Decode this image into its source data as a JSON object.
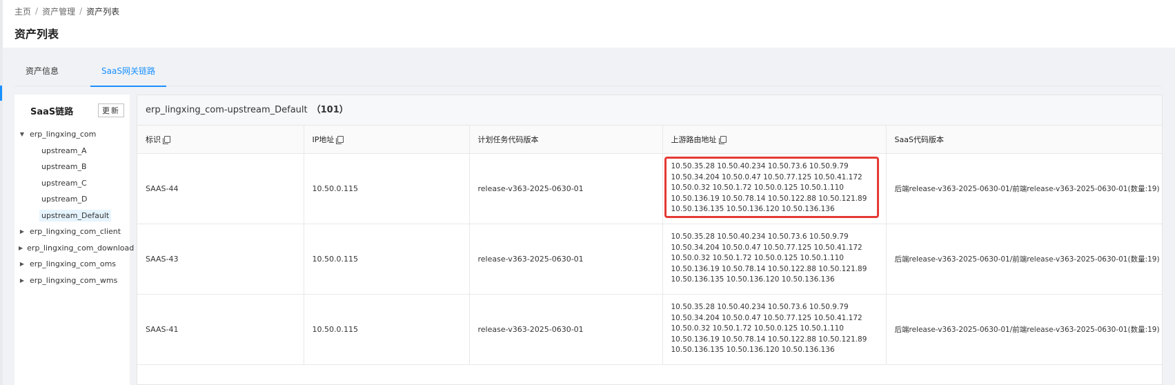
{
  "breadcrumb": {
    "home": "主页",
    "assets": "资产管理",
    "current": "资产列表",
    "sep": "/"
  },
  "page_title": "资产列表",
  "tabs": [
    {
      "label": "资产信息",
      "active": false
    },
    {
      "label": "SaaS网关链路",
      "active": true
    }
  ],
  "sidebar": {
    "title": "SaaS链路",
    "refresh_label": "更新",
    "tree": {
      "expanded": {
        "label": "erp_lingxing_com",
        "children": [
          "upstream_A",
          "upstream_B",
          "upstream_C",
          "upstream_D",
          "upstream_Default"
        ],
        "selected": "upstream_Default"
      },
      "collapsed": [
        "erp_lingxing_com_client",
        "erp_lingxing_com_download",
        "erp_lingxing_com_oms",
        "erp_lingxing_com_wms"
      ]
    }
  },
  "panel": {
    "title": "erp_lingxing_com-upstream_Default",
    "count": "（101）"
  },
  "table": {
    "columns": [
      "标识",
      "IP地址",
      "计划任务代码版本",
      "上游路由地址",
      "SaaS代码版本"
    ],
    "rows": [
      {
        "id": "SAAS-44",
        "ip": "10.50.0.115",
        "plan_version": "release-v363-2025-0630-01",
        "upstream": "10.50.35.28 10.50.40.234 10.50.73.6 10.50.9.79 10.50.34.204 10.50.0.47 10.50.77.125 10.50.41.172 10.50.0.32 10.50.1.72 10.50.0.125 10.50.1.110 10.50.136.19 10.50.78.14 10.50.122.88 10.50.121.89 10.50.136.135 10.50.136.120 10.50.136.136",
        "saas_version": "后端release-v363-2025-0630-01/前端release-v363-2025-0630-01(数量:19)",
        "highlighted": true
      },
      {
        "id": "SAAS-43",
        "ip": "10.50.0.115",
        "plan_version": "release-v363-2025-0630-01",
        "upstream": "10.50.35.28 10.50.40.234 10.50.73.6 10.50.9.79 10.50.34.204 10.50.0.47 10.50.77.125 10.50.41.172 10.50.0.32 10.50.1.72 10.50.0.125 10.50.1.110 10.50.136.19 10.50.78.14 10.50.122.88 10.50.121.89 10.50.136.135 10.50.136.120 10.50.136.136",
        "saas_version": "后端release-v363-2025-0630-01/前端release-v363-2025-0630-01(数量:19)",
        "highlighted": false
      },
      {
        "id": "SAAS-41",
        "ip": "10.50.0.115",
        "plan_version": "release-v363-2025-0630-01",
        "upstream": "10.50.35.28 10.50.40.234 10.50.73.6 10.50.9.79 10.50.34.204 10.50.0.47 10.50.77.125 10.50.41.172 10.50.0.32 10.50.1.72 10.50.0.125 10.50.1.110 10.50.136.19 10.50.78.14 10.50.122.88 10.50.121.89 10.50.136.135 10.50.136.120 10.50.136.136",
        "saas_version": "后端release-v363-2025-0630-01/前端release-v363-2025-0630-01(数量:19)",
        "highlighted": false
      }
    ]
  },
  "colors": {
    "accent": "#1890ff",
    "highlight": "#e53935"
  },
  "icons": {
    "copy": "copy-icon",
    "expand": "caret-down-icon",
    "collapse": "caret-right-icon"
  }
}
